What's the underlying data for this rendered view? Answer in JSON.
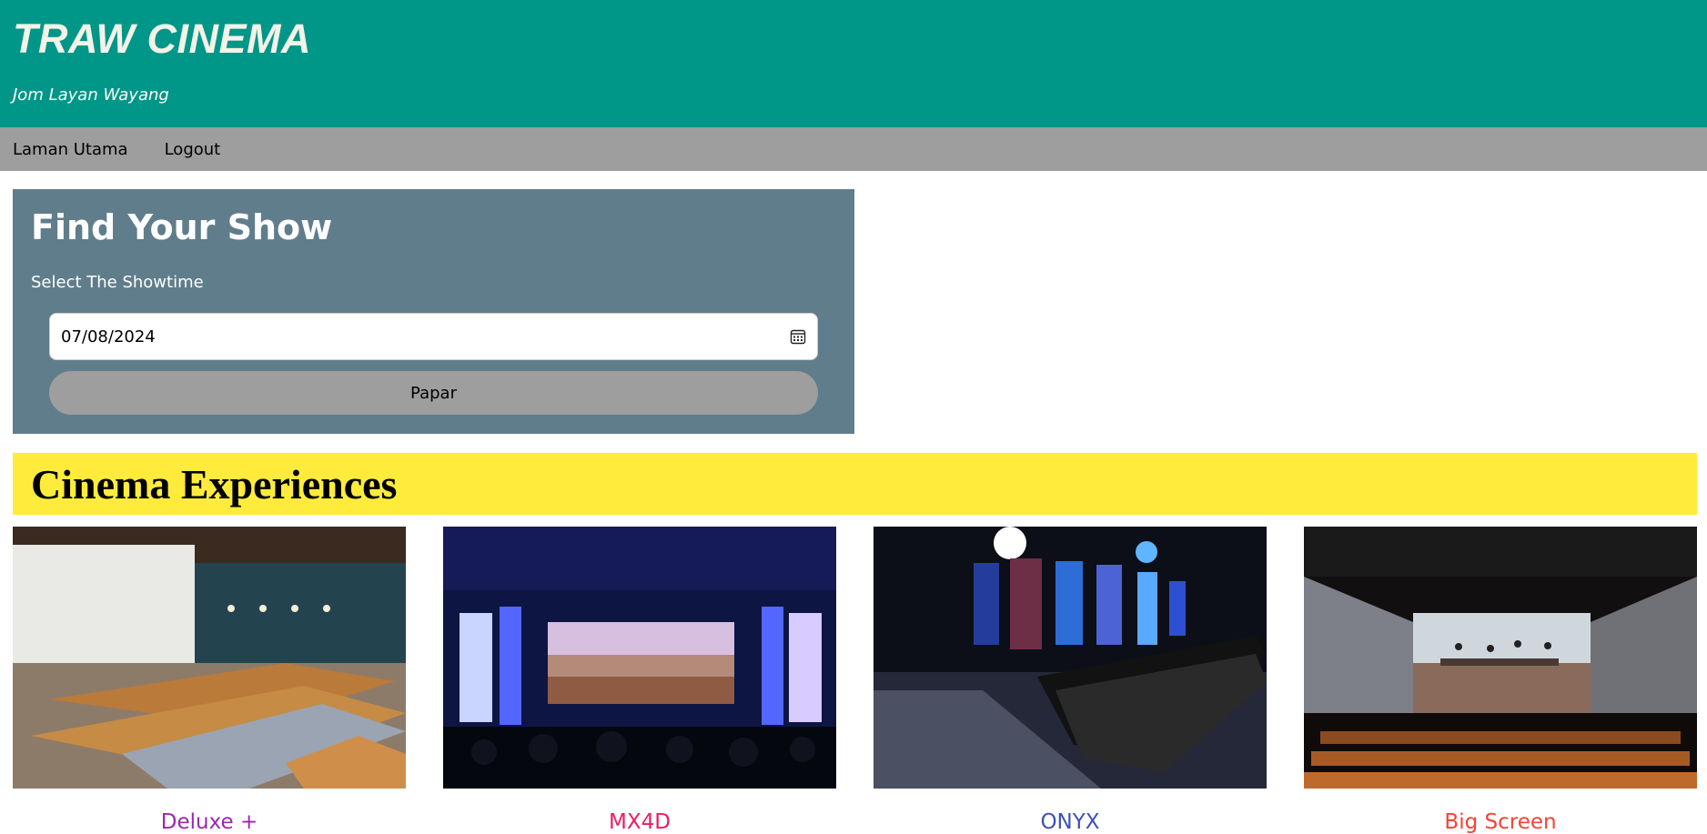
{
  "header": {
    "title": "TRAW CINEMA",
    "tagline": "Jom Layan Wayang"
  },
  "nav": {
    "items": [
      {
        "label": "Laman Utama"
      },
      {
        "label": "Logout"
      }
    ]
  },
  "find_show": {
    "title": "Find Your Show",
    "label": "Select The Showtime",
    "date_value": "07/08/2024",
    "button_label": "Papar"
  },
  "experiences": {
    "title": "Cinema Experiences",
    "items": [
      {
        "label": "Deluxe +",
        "color": "#9c27b0"
      },
      {
        "label": "MX4D",
        "color": "#e91e63"
      },
      {
        "label": "ONYX",
        "color": "#3f51b5"
      },
      {
        "label": "Big Screen",
        "color": "#f44336"
      }
    ]
  },
  "colors": {
    "header_bg": "#009688",
    "nav_bg": "#9e9e9e",
    "panel_bg": "#607d8b",
    "banner_bg": "#ffeb3b"
  },
  "icons": {
    "date_picker": "calendar-icon"
  }
}
